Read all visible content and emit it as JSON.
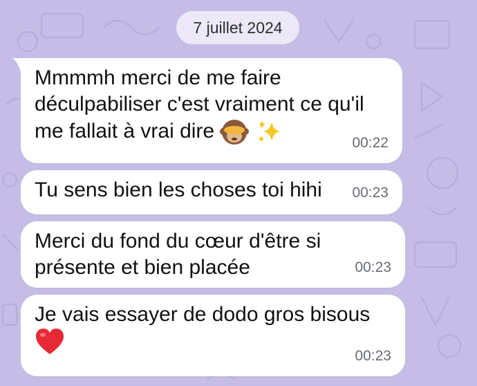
{
  "date_separator": "7 juillet 2024",
  "messages": [
    {
      "lines": [
        "Mmmmh merci de me faire",
        "déculpabiliser c'est vraiment ce qu'il",
        "me fallait à vrai dire"
      ],
      "emojis": [
        "see-no-evil-monkey-emoji",
        "sparkles-emoji"
      ],
      "time": "00:22"
    },
    {
      "lines": [
        "Tu sens bien les choses toi hihi"
      ],
      "time": "00:23"
    },
    {
      "lines": [
        "Merci du fond du cœur d'être si",
        "présente et bien placée"
      ],
      "time": "00:23"
    },
    {
      "lines": [
        "Je vais essayer de dodo gros bisous"
      ],
      "emojis": [
        "red-heart-emoji"
      ],
      "time": "00:23"
    }
  ],
  "colors": {
    "wallpaper": "#c6bde6",
    "bubble": "#ffffff",
    "date_pill": "#ece8f7",
    "timestamp": "#666b73"
  }
}
